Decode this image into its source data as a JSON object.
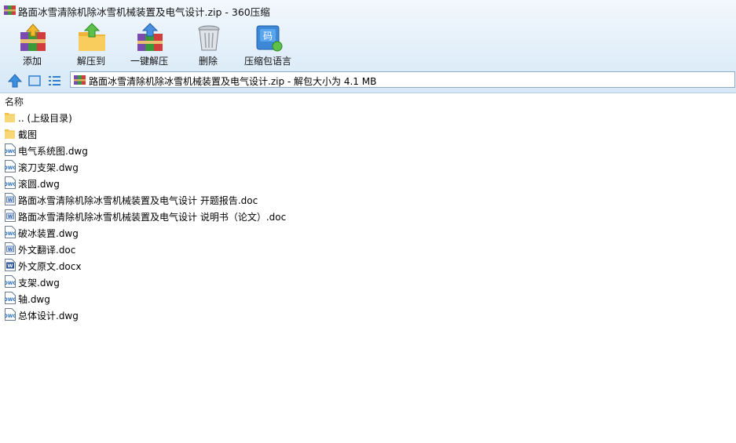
{
  "window": {
    "title": "路面冰雪清除机除冰雪机械装置及电气设计.zip - 360压缩"
  },
  "toolbar": {
    "buttons": [
      {
        "label": "添加",
        "icon": "add-archive-icon"
      },
      {
        "label": "解压到",
        "icon": "extract-to-icon"
      },
      {
        "label": "一键解压",
        "icon": "one-click-extract-icon"
      },
      {
        "label": "删除",
        "icon": "trash-can-icon"
      },
      {
        "label": "压缩包语言",
        "icon": "archive-language-icon"
      }
    ]
  },
  "nav": {
    "address": "路面冰雪清除机除冰雪机械装置及电气设计.zip - 解包大小为 4.1 MB"
  },
  "list": {
    "column_name": "名称",
    "items": [
      {
        "name": ".. (上级目录)",
        "type": "folder"
      },
      {
        "name": "截图",
        "type": "folder"
      },
      {
        "name": "电气系统图.dwg",
        "type": "dwg"
      },
      {
        "name": "滚刀支架.dwg",
        "type": "dwg"
      },
      {
        "name": "滚圆.dwg",
        "type": "dwg"
      },
      {
        "name": "路面冰雪清除机除冰雪机械装置及电气设计 开题报告.doc",
        "type": "doc"
      },
      {
        "name": "路面冰雪清除机除冰雪机械装置及电气设计 说明书（论文）.doc",
        "type": "doc"
      },
      {
        "name": "破冰装置.dwg",
        "type": "dwg"
      },
      {
        "name": "外文翻译.doc",
        "type": "doc"
      },
      {
        "name": "外文原文.docx",
        "type": "docx"
      },
      {
        "name": "支架.dwg",
        "type": "dwg"
      },
      {
        "name": "轴.dwg",
        "type": "dwg"
      },
      {
        "name": "总体设计.dwg",
        "type": "dwg"
      }
    ]
  },
  "colors": {
    "accent": "#2f7fd0",
    "toolbar_bg": "#e1eef9",
    "folder": "#f6d57c"
  }
}
